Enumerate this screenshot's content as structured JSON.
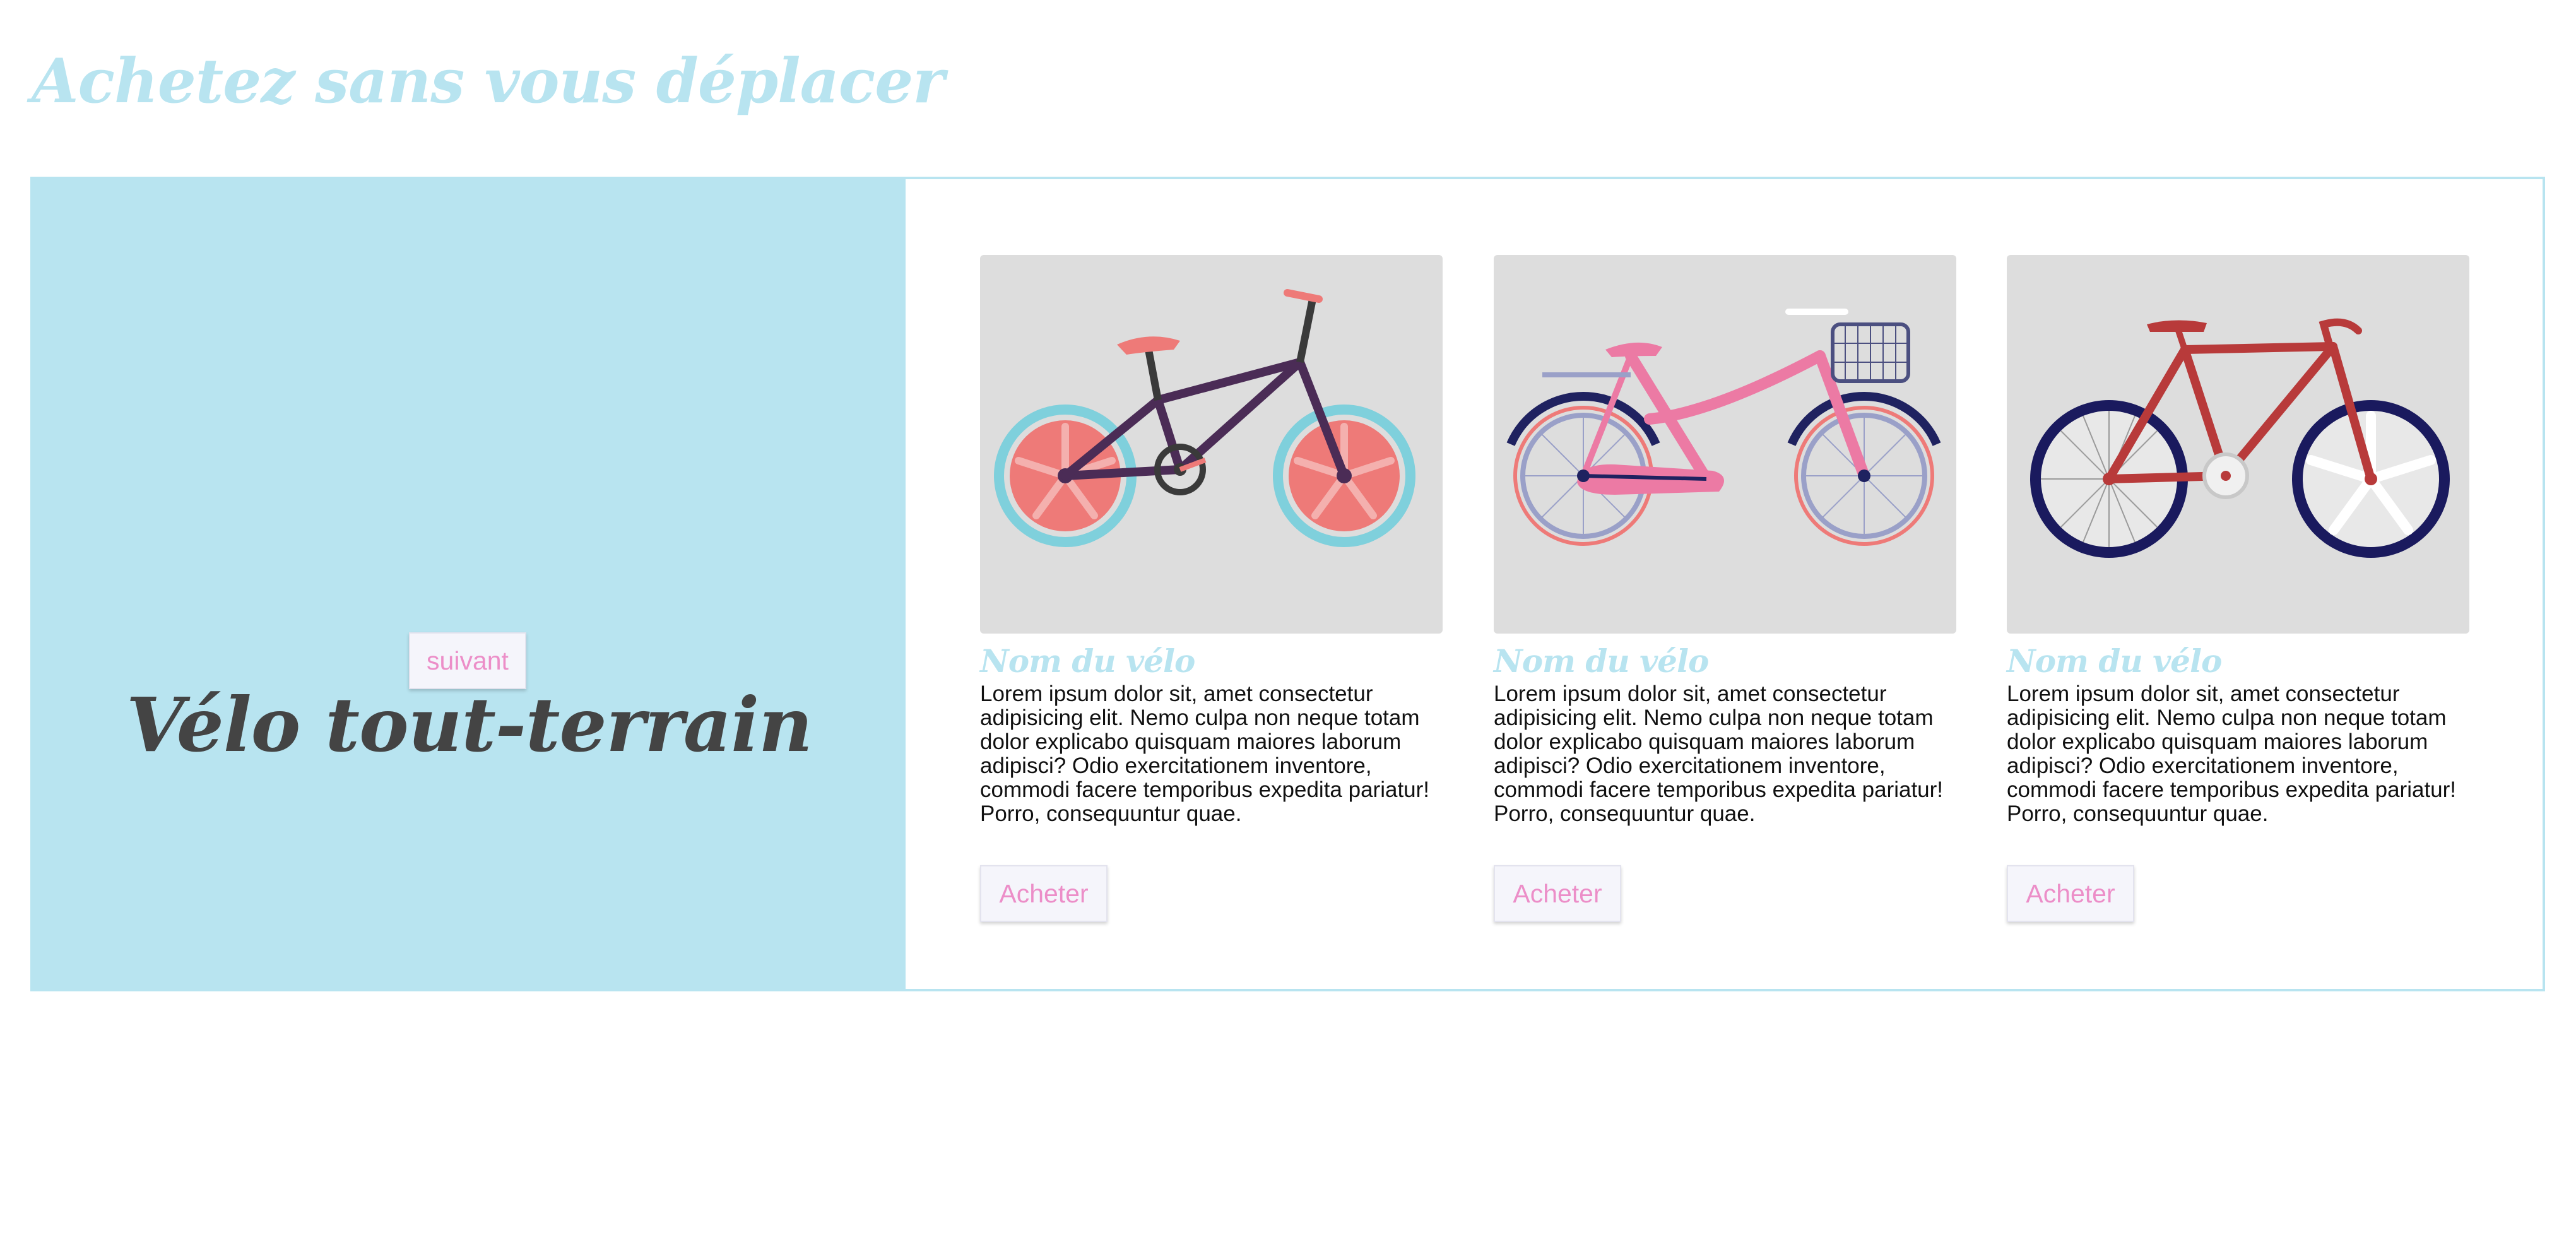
{
  "page": {
    "title": "Achetez sans vous déplacer"
  },
  "hero": {
    "title": "Vélo tout-terrain",
    "next_label": "suivant"
  },
  "products": [
    {
      "name": "Nom du vélo",
      "description": "Lorem ipsum dolor sit, amet consectetur adipisicing elit. Nemo culpa non neque totam dolor explicabo quisquam maiores laborum adipisci? Odio exercitationem inventore, commodi facere temporibus expedita pariatur! Porro, consequuntur quae.",
      "buy_label": "Acheter"
    },
    {
      "name": "Nom du vélo",
      "description": "Lorem ipsum dolor sit, amet consectetur adipisicing elit. Nemo culpa non neque totam dolor explicabo quisquam maiores laborum adipisci? Odio exercitationem inventore, commodi facere temporibus expedita pariatur! Porro, consequuntur quae.",
      "buy_label": "Acheter"
    },
    {
      "name": "Nom du vélo",
      "description": "Lorem ipsum dolor sit, amet consectetur adipisicing elit. Nemo culpa non neque totam dolor explicabo quisquam maiores laborum adipisci? Odio exercitationem inventore, commodi facere temporibus expedita pariatur! Porro, consequuntur quae.",
      "buy_label": "Acheter"
    }
  ],
  "colors": {
    "accent": "#b8e4f0",
    "button_text": "#ec8ec8",
    "hero_text": "#444444",
    "image_bg": "#dddddd"
  },
  "icons": [
    "bmx-bike-illustration",
    "city-bike-with-basket-illustration",
    "road-bike-illustration"
  ]
}
